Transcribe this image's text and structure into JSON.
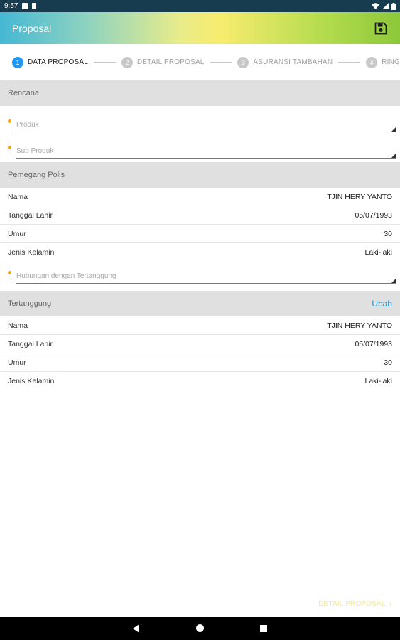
{
  "status_bar": {
    "time": "9:57",
    "icons": [
      "notification-icon",
      "sim-icon",
      "wifi-icon",
      "signal-icon",
      "battery-icon"
    ]
  },
  "app_bar": {
    "title": "Proposal",
    "save_icon": "save-icon"
  },
  "stepper": [
    {
      "number": "1",
      "label": "DATA PROPOSAL",
      "active": true
    },
    {
      "number": "2",
      "label": "DETAIL PROPOSAL",
      "active": false
    },
    {
      "number": "3",
      "label": "ASURANSI TAMBAHAN",
      "active": false
    },
    {
      "number": "4",
      "label": "RING",
      "active": false
    }
  ],
  "rencana": {
    "header": "Rencana",
    "produk_placeholder": "Produk",
    "sub_produk_placeholder": "Sub Produk"
  },
  "pemegang_polis": {
    "header": "Pemegang Polis",
    "rows": [
      {
        "label": "Nama",
        "value": "TJIN HERY YANTO"
      },
      {
        "label": "Tanggal Lahir",
        "value": "05/07/1993"
      },
      {
        "label": "Umur",
        "value": "30"
      },
      {
        "label": "Jenis Kelamin",
        "value": "Laki-laki"
      }
    ],
    "hubungan_placeholder": "Hubungan dengan Tertanggung"
  },
  "tertanggung": {
    "header": "Tertanggung",
    "action": "Ubah",
    "rows": [
      {
        "label": "Nama",
        "value": "TJIN HERY YANTO"
      },
      {
        "label": "Tanggal Lahir",
        "value": "05/07/1993"
      },
      {
        "label": "Umur",
        "value": "30"
      },
      {
        "label": "Jenis Kelamin",
        "value": "Laki-laki"
      }
    ]
  },
  "footer": {
    "next_label": "DETAIL PROPOSAL",
    "chevron": "›"
  },
  "colors": {
    "accent_blue": "#2196f3",
    "required_dot": "#f4a300",
    "link": "#1e8fd6",
    "status_bar": "#173c4f"
  }
}
